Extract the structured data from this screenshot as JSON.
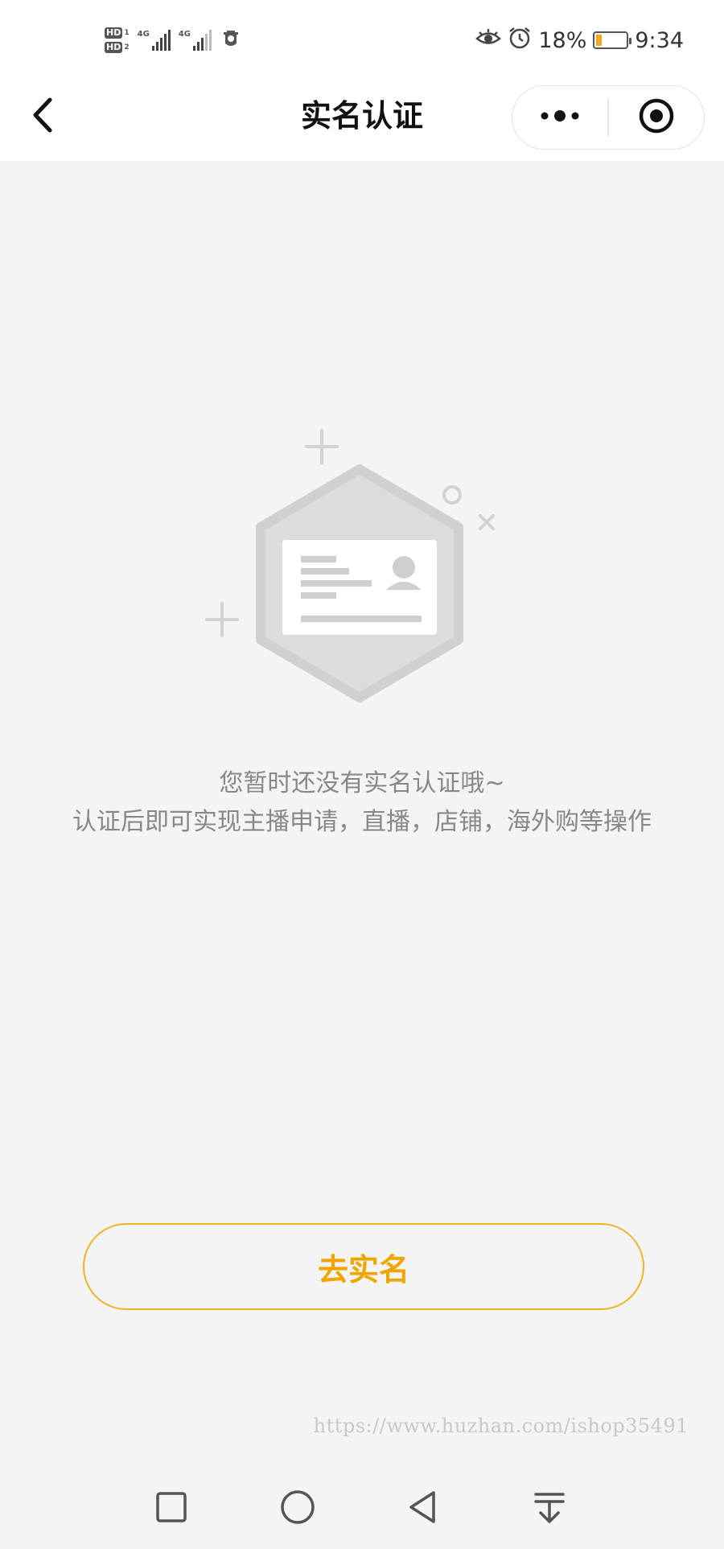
{
  "status_bar": {
    "hd1": "HD",
    "hd1_index": "1",
    "hd2": "HD",
    "hd2_index": "2",
    "network1": "4G",
    "network2": "4G",
    "battery_percent": "18%",
    "battery_level": 0.18,
    "time": "9:34",
    "icons": [
      "eye-comfort-icon",
      "alarm-icon",
      "battery-icon",
      "notification-icon"
    ]
  },
  "nav": {
    "title": "实名认证",
    "icons": [
      "back-arrow-icon",
      "more-dots-icon",
      "close-target-icon"
    ]
  },
  "empty_state": {
    "illustration": "id-card-hexagon-icon",
    "line1": "您暂时还没有实名认证哦~",
    "line2": "认证后即可实现主播申请，直播，店铺，海外购等操作"
  },
  "action": {
    "button_label": "去实名"
  },
  "watermark": "https://www.huzhan.com/ishop35491",
  "system_nav": {
    "icons": [
      "recent-apps-icon",
      "home-icon",
      "back-icon",
      "notification-pull-icon"
    ]
  },
  "colors": {
    "accent": "#f0a500",
    "accent_border": "#f0b429",
    "background": "#f4f4f4",
    "header_bg": "#ffffff",
    "muted_text": "#888888"
  }
}
